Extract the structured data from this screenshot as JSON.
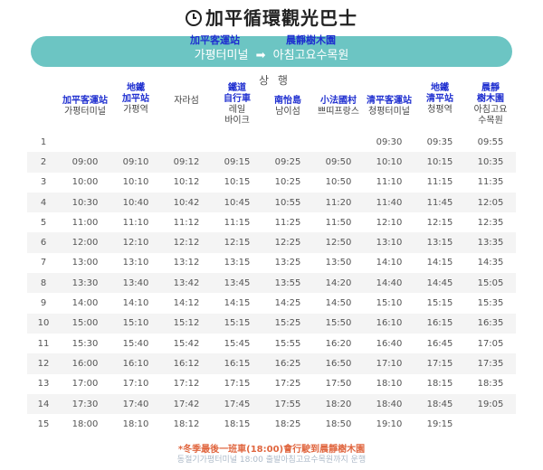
{
  "page": {
    "title": "加平循環觀光巴士"
  },
  "route": {
    "from_zh": "加平客運站",
    "to_zh": "晨靜樹木園",
    "from_ko": "가평터미널",
    "arrow": "➡",
    "to_ko": "아침고요수목원"
  },
  "direction_label": "상 행",
  "stops": [
    {
      "zh": "加平客運站",
      "ko": "가평터미널"
    },
    {
      "zh": "地鐵\n加平站",
      "ko": "가평역"
    },
    {
      "zh": "",
      "ko": "자라섬"
    },
    {
      "zh": "鐵道\n自行車",
      "ko": "레일\n바이크"
    },
    {
      "zh": "南怡島",
      "ko": "남이섬"
    },
    {
      "zh": "小法國村",
      "ko": "쁘띠프랑스"
    },
    {
      "zh": "清平客運站",
      "ko": "청평터미널"
    },
    {
      "zh": "地鐵\n清平站",
      "ko": "청평역"
    },
    {
      "zh": "晨靜\n樹木園",
      "ko": "아침고요\n수목원"
    }
  ],
  "rows": [
    {
      "no": "1",
      "times": [
        "",
        "",
        "",
        "",
        "",
        "",
        "09:30",
        "09:35",
        "09:55"
      ]
    },
    {
      "no": "2",
      "times": [
        "09:00",
        "09:10",
        "09:12",
        "09:15",
        "09:25",
        "09:50",
        "10:10",
        "10:15",
        "10:35"
      ]
    },
    {
      "no": "3",
      "times": [
        "10:00",
        "10:10",
        "10:12",
        "10:15",
        "10:25",
        "10:50",
        "11:10",
        "11:15",
        "11:35"
      ]
    },
    {
      "no": "4",
      "times": [
        "10:30",
        "10:40",
        "10:42",
        "10:45",
        "10:55",
        "11:20",
        "11:40",
        "11:45",
        "12:05"
      ]
    },
    {
      "no": "5",
      "times": [
        "11:00",
        "11:10",
        "11:12",
        "11:15",
        "11:25",
        "11:50",
        "12:10",
        "12:15",
        "12:35"
      ]
    },
    {
      "no": "6",
      "times": [
        "12:00",
        "12:10",
        "12:12",
        "12:15",
        "12:25",
        "12:50",
        "13:10",
        "13:15",
        "13:35"
      ]
    },
    {
      "no": "7",
      "times": [
        "13:00",
        "13:10",
        "13:12",
        "13:15",
        "13:25",
        "13:50",
        "14:10",
        "14:15",
        "14:35"
      ]
    },
    {
      "no": "8",
      "times": [
        "13:30",
        "13:40",
        "13:42",
        "13:45",
        "13:55",
        "14:20",
        "14:40",
        "14:45",
        "15:05"
      ]
    },
    {
      "no": "9",
      "times": [
        "14:00",
        "14:10",
        "14:12",
        "14:15",
        "14:25",
        "14:50",
        "15:10",
        "15:15",
        "15:35"
      ]
    },
    {
      "no": "10",
      "times": [
        "15:00",
        "15:10",
        "15:12",
        "15:15",
        "15:25",
        "15:50",
        "16:10",
        "16:15",
        "16:35"
      ]
    },
    {
      "no": "11",
      "times": [
        "15:30",
        "15:40",
        "15:42",
        "15:45",
        "15:55",
        "16:20",
        "16:40",
        "16:45",
        "17:05"
      ]
    },
    {
      "no": "12",
      "times": [
        "16:00",
        "16:10",
        "16:12",
        "16:15",
        "16:25",
        "16:50",
        "17:10",
        "17:15",
        "17:35"
      ]
    },
    {
      "no": "13",
      "times": [
        "17:00",
        "17:10",
        "17:12",
        "17:15",
        "17:25",
        "17:50",
        "18:10",
        "18:15",
        "18:35"
      ]
    },
    {
      "no": "14",
      "times": [
        "17:30",
        "17:40",
        "17:42",
        "17:45",
        "17:55",
        "18:20",
        "18:40",
        "18:45",
        "19:05"
      ]
    },
    {
      "no": "15",
      "times": [
        "18:00",
        "18:10",
        "18:12",
        "18:15",
        "18:25",
        "18:50",
        "19:10",
        "19:15",
        ""
      ]
    }
  ],
  "footer": {
    "note_zh": "*冬季最後一班車(18:00)會行駛到晨靜樹木園",
    "note_ko": "동절기가평터미널 18:00 출발아침고요수목원까지 운행"
  }
}
